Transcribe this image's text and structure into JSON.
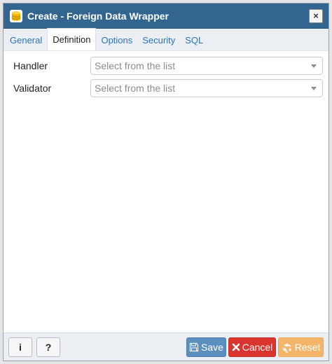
{
  "window": {
    "title": "Create - Foreign Data Wrapper",
    "close_label": "×"
  },
  "tabs": [
    {
      "label": "General",
      "active": false
    },
    {
      "label": "Definition",
      "active": true
    },
    {
      "label": "Options",
      "active": false
    },
    {
      "label": "Security",
      "active": false
    },
    {
      "label": "SQL",
      "active": false
    }
  ],
  "form": {
    "handler": {
      "label": "Handler",
      "placeholder": "Select from the list"
    },
    "validator": {
      "label": "Validator",
      "placeholder": "Select from the list"
    }
  },
  "footer": {
    "info_label": "i",
    "help_label": "?",
    "save_label": "Save",
    "cancel_label": "Cancel",
    "reset_label": "Reset"
  },
  "icons": {
    "title": "database-icon",
    "save": "floppy-disk-icon",
    "cancel": "x-icon",
    "reset": "recycle-icon"
  },
  "colors": {
    "titlebar": "#326690",
    "save": "#5b8fc0",
    "cancel": "#d9352f",
    "reset": "#f4b56a",
    "tab_link": "#2c74b3"
  }
}
